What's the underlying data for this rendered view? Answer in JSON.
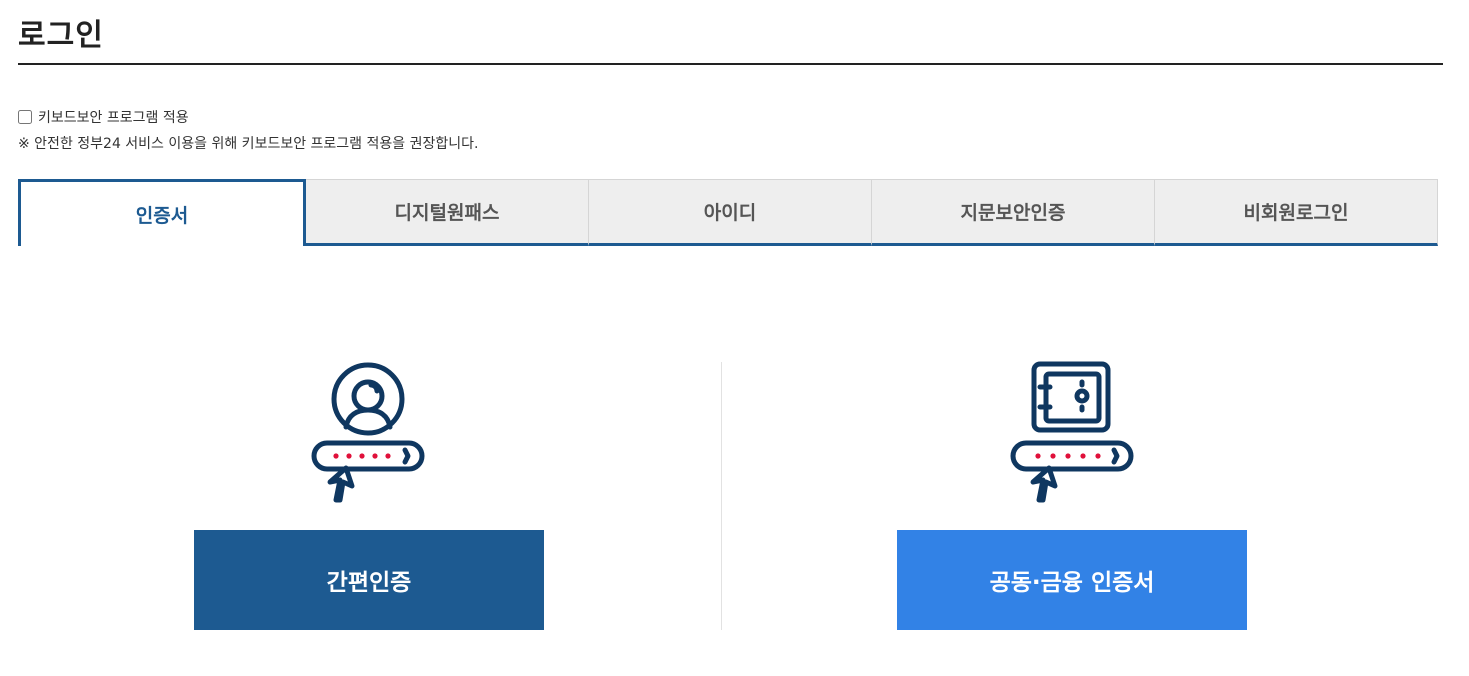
{
  "page": {
    "title": "로그인"
  },
  "keyboard_security": {
    "checkbox_label": "키보드보안 프로그램 적용",
    "checked": false,
    "note": "※ 안전한 정부24 서비스 이용을 위해 키보드보안 프로그램 적용을 권장합니다."
  },
  "tabs": [
    {
      "label": "인증서",
      "active": true
    },
    {
      "label": "디지털원패스",
      "active": false
    },
    {
      "label": "아이디",
      "active": false
    },
    {
      "label": "지문보안인증",
      "active": false
    },
    {
      "label": "비회원로그인",
      "active": false
    }
  ],
  "options": {
    "simple_auth": {
      "label": "간편인증",
      "icon": "user-password-icon"
    },
    "joint_financial_cert": {
      "label": "공동·금융 인증서",
      "icon": "safe-password-icon"
    }
  },
  "colors": {
    "primary": "#1d5a91",
    "accent": "#3282e6",
    "icon_dots": "#e0103a"
  }
}
